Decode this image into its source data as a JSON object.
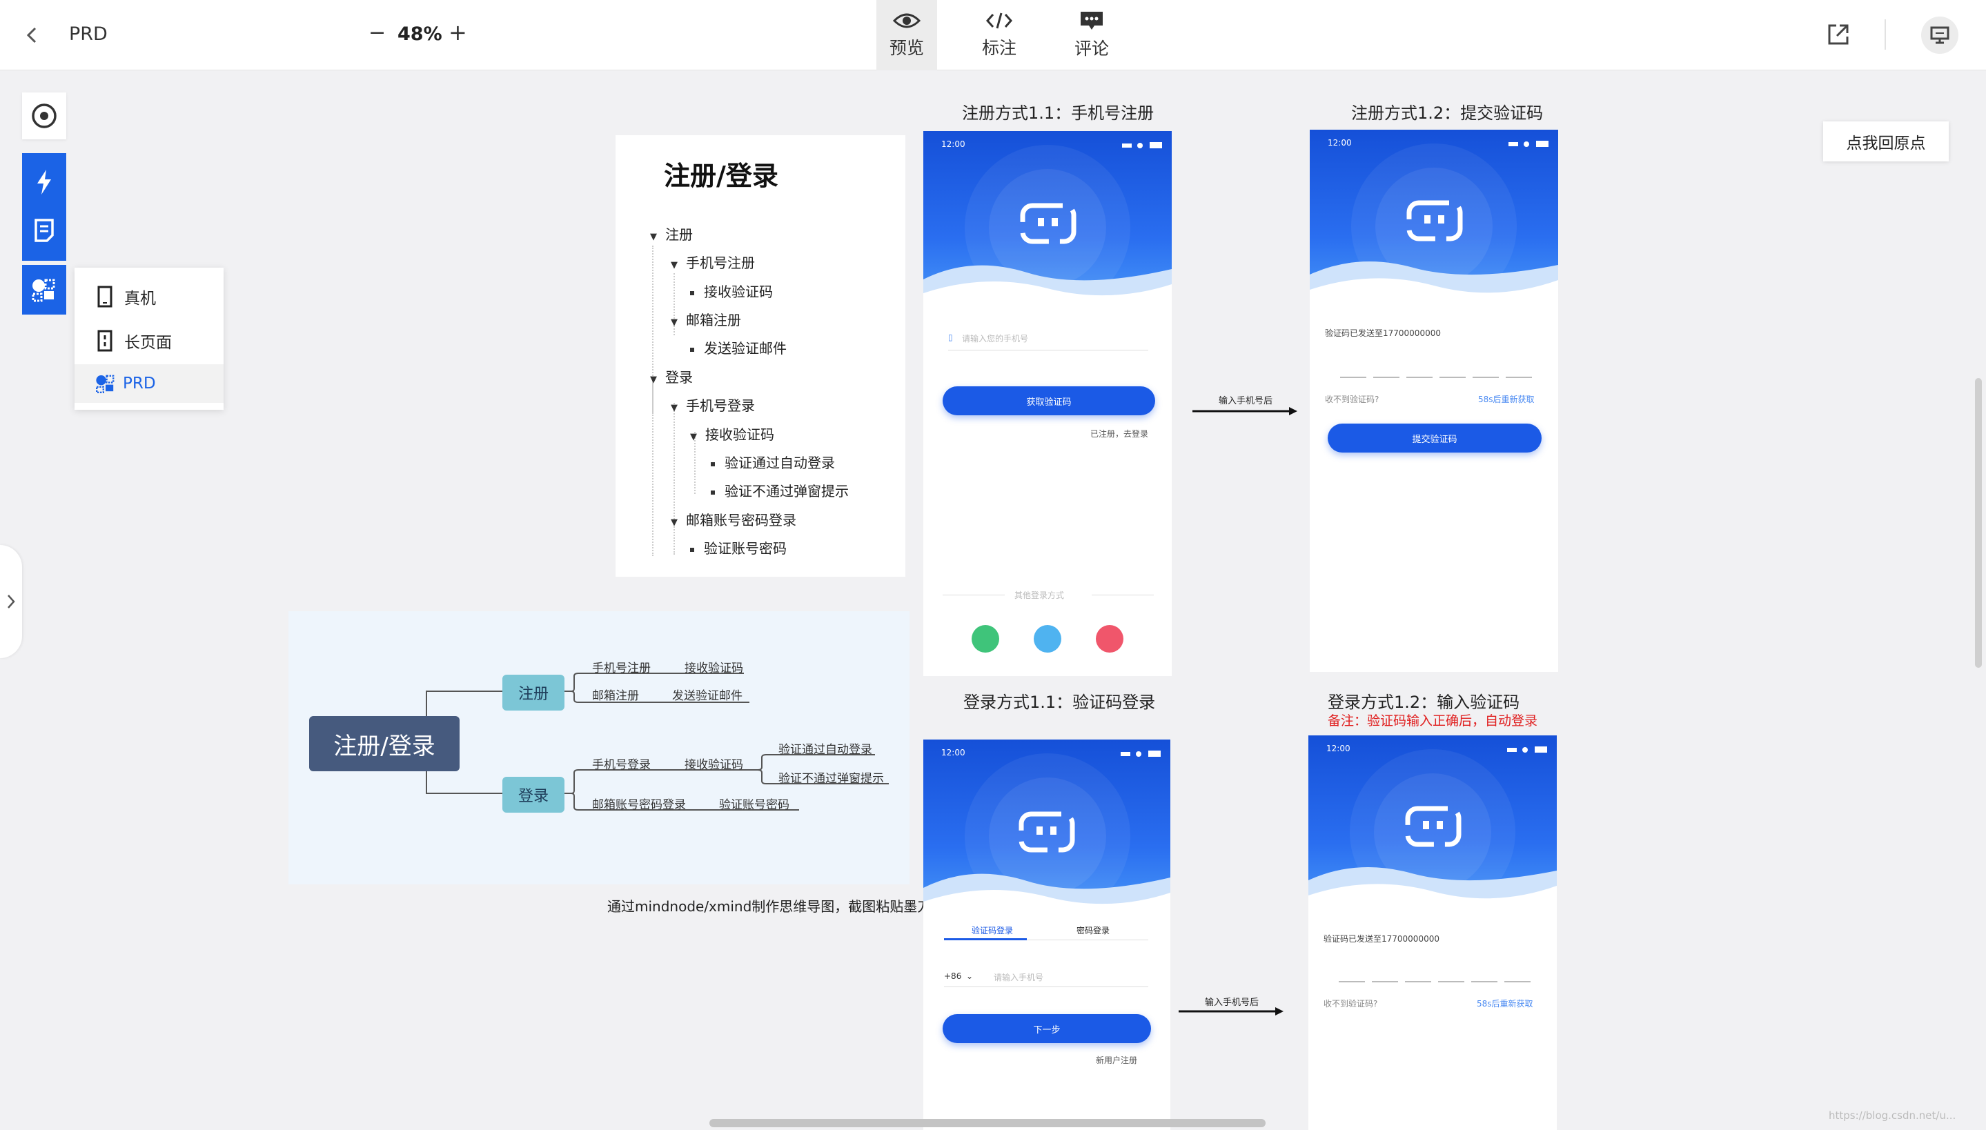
{
  "topbar": {
    "title": "PRD",
    "zoom": "48%",
    "zoom_out": "−",
    "zoom_in": "+",
    "tabs": [
      {
        "label": "预览",
        "icon": "eye-icon",
        "active": true
      },
      {
        "label": "标注",
        "icon": "code-icon",
        "active": false
      },
      {
        "label": "评论",
        "icon": "comment-icon",
        "active": false
      }
    ]
  },
  "reset_button": "点我回原点",
  "view_menu": {
    "items": [
      {
        "label": "真机",
        "icon": "phone-icon"
      },
      {
        "label": "长页面",
        "icon": "long-page-icon"
      },
      {
        "label": "PRD",
        "icon": "prd-icon",
        "selected": true
      }
    ]
  },
  "outline": {
    "title": "注册/登录",
    "items": [
      {
        "text": "注册",
        "level": 0,
        "bullet": "triangle"
      },
      {
        "text": "手机号注册",
        "level": 1,
        "bullet": "triangle"
      },
      {
        "text": "接收验证码",
        "level": 2,
        "bullet": "square"
      },
      {
        "text": "邮箱注册",
        "level": 1,
        "bullet": "triangle"
      },
      {
        "text": "发送验证邮件",
        "level": 2,
        "bullet": "square"
      },
      {
        "text": "登录",
        "level": 0,
        "bullet": "triangle"
      },
      {
        "text": "手机号登录",
        "level": 1,
        "bullet": "triangle"
      },
      {
        "text": "接收验证码",
        "level": 2,
        "bullet": "triangle"
      },
      {
        "text": "验证通过自动登录",
        "level": 3,
        "bullet": "square"
      },
      {
        "text": "验证不通过弹窗提示",
        "level": 3,
        "bullet": "square"
      },
      {
        "text": "邮箱账号密码登录",
        "level": 1,
        "bullet": "triangle"
      },
      {
        "text": "验证账号密码",
        "level": 2,
        "bullet": "square"
      }
    ]
  },
  "mindmap": {
    "root": "注册/登录",
    "register": "注册",
    "login": "登录",
    "reg_phone": "手机号注册",
    "reg_phone_code": "接收验证码",
    "reg_email": "邮箱注册",
    "reg_email_send": "发送验证邮件",
    "login_phone": "手机号登录",
    "login_phone_code": "接收验证码",
    "login_ok": "验证通过自动登录",
    "login_fail": "验证不通过弹窗提示",
    "login_email": "邮箱账号密码登录",
    "login_email_verify": "验证账号密码",
    "caption": "通过mindnode/xmind制作思维导图，截图粘贴墨刀"
  },
  "screens": {
    "reg1": {
      "title": "注册方式1.1：手机号注册",
      "time": "12:00",
      "phone_placeholder": "请输入您的手机号",
      "button": "获取验证码",
      "link": "已注册，去登录",
      "other": "其他登录方式"
    },
    "reg2": {
      "title": "注册方式1.2：提交验证码",
      "time": "12:00",
      "sent": "验证码已发送至17700000000",
      "not_received": "收不到验证码?",
      "resend": "58s后重新获取",
      "button": "提交验证码"
    },
    "login1": {
      "title": "登录方式1.1：验证码登录",
      "time": "12:00",
      "tab_code": "验证码登录",
      "tab_pwd": "密码登录",
      "country": "+86",
      "phone_placeholder": "请输入手机号",
      "button": "下一步",
      "link": "新用户注册"
    },
    "login2": {
      "title": "登录方式1.2：输入验证码",
      "note": "备注：验证码输入正确后，自动登录",
      "time": "12:00",
      "sent": "验证码已发送至17700000000",
      "not_received": "收不到验证码?",
      "resend": "58s后重新获取"
    }
  },
  "arrows": {
    "top": "输入手机号后",
    "bottom": "输入手机号后"
  },
  "watermark": "https://blog.csdn.net/u...",
  "colors": {
    "accent": "#1b5ae6",
    "mindmap_root": "#465a7e",
    "mindmap_branch": "#7cc6d6",
    "note_red": "#e02020"
  }
}
